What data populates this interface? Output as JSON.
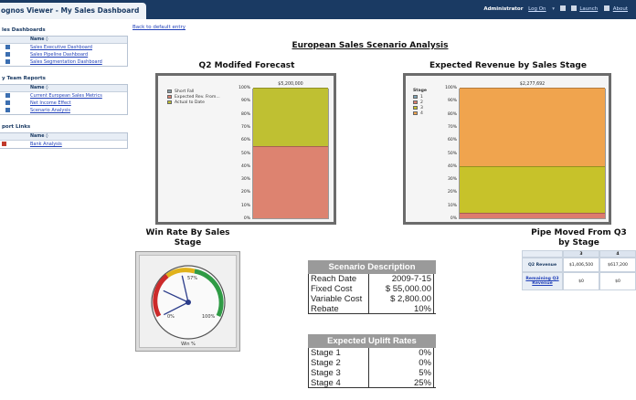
{
  "window": {
    "tab_title": "ognos Viewer - My Sales Dashboard"
  },
  "topnav": {
    "user": "Administrator",
    "logon": "Log On",
    "launch": "Launch",
    "about": "About"
  },
  "sidebar": {
    "sections": [
      {
        "title": "les Dashboards",
        "header": "Name ◊",
        "items": [
          "Sales Executive Dashboard",
          "Sales Pipeline Dashboard",
          "Sales Segmentation Dashboard"
        ]
      },
      {
        "title": "y Team Reports",
        "header": "Name ◊",
        "items": [
          "Current European Sales Metrics",
          "Net Income Effect",
          "Scenario Analysis"
        ]
      },
      {
        "title": "port Links",
        "header": "Name ◊",
        "items": [
          "Bank Analysis"
        ]
      }
    ]
  },
  "back_link": "Back to default entry",
  "main_title": "European Sales Scenario Analysis",
  "chart_data": [
    {
      "type": "bar",
      "title": "Q2 Modifed Forecast",
      "stacked": "100%",
      "legend": [
        "Short Fall",
        "Expected Rev. From...",
        "Actual to Date"
      ],
      "colors": [
        "#8aa0a8",
        "#dd8370",
        "#bfc032"
      ],
      "categories": [
        ""
      ],
      "series": [
        {
          "name": "Short Fall",
          "values": [
            0
          ]
        },
        {
          "name": "Expected Rev. From...",
          "values": [
            55
          ]
        },
        {
          "name": "Actual to Date",
          "values": [
            45
          ]
        }
      ],
      "total_label": "$5,200,000",
      "yticks": [
        "100%",
        "90%",
        "80%",
        "70%",
        "60%",
        "50%",
        "40%",
        "30%",
        "20%",
        "10%",
        "0%"
      ]
    },
    {
      "type": "bar",
      "title": "Expected Revenue by Sales Stage",
      "stacked": "100%",
      "legend_title": "Stage",
      "legend": [
        "1",
        "2",
        "3",
        "4"
      ],
      "colors": [
        "#7da3b6",
        "#dd7b6e",
        "#c7c22a",
        "#f0a44e"
      ],
      "categories": [
        ""
      ],
      "series": [
        {
          "name": "1",
          "values": [
            0
          ]
        },
        {
          "name": "2",
          "values": [
            4
          ]
        },
        {
          "name": "3",
          "values": [
            36
          ]
        },
        {
          "name": "4",
          "values": [
            60
          ]
        }
      ],
      "total_label": "$2,277,692",
      "yticks": [
        "100%",
        "90%",
        "80%",
        "70%",
        "60%",
        "50%",
        "40%",
        "30%",
        "20%",
        "10%",
        "0%"
      ]
    }
  ],
  "gauge": {
    "title_line1": "Win Rate By Sales",
    "title_line2": "Stage",
    "label_left": "0%",
    "label_right": "100%",
    "label_top": "57%",
    "axis_label": "Win %",
    "needle_values": [
      0.05,
      0.25,
      0.45
    ]
  },
  "scenario": {
    "title": "Scenario Description",
    "rows": [
      {
        "label": "Reach Date",
        "value": "2009-7-15"
      },
      {
        "label": "Fixed Cost",
        "value": "$ 55,000.00"
      },
      {
        "label": "Variable Cost",
        "value": "$ 2,800.00"
      },
      {
        "label": "Rebate",
        "value": "10%"
      }
    ]
  },
  "uplift": {
    "title": "Expected Uplift Rates",
    "rows": [
      {
        "label": "Stage 1",
        "value": "0%"
      },
      {
        "label": "Stage 2",
        "value": "0%"
      },
      {
        "label": "Stage 3",
        "value": "5%"
      },
      {
        "label": "Stage 4",
        "value": "25%"
      }
    ]
  },
  "pipe": {
    "title_line1": "Pipe Moved From Q3",
    "title_line2": "by Stage",
    "columns": [
      "3",
      "4"
    ],
    "rows": [
      {
        "label": "Q2 Revenue",
        "values": [
          "$1,406,500",
          "$617,200"
        ]
      },
      {
        "label": "Remaining Q3 Revenue",
        "values": [
          "$0",
          "$0"
        ]
      }
    ]
  }
}
